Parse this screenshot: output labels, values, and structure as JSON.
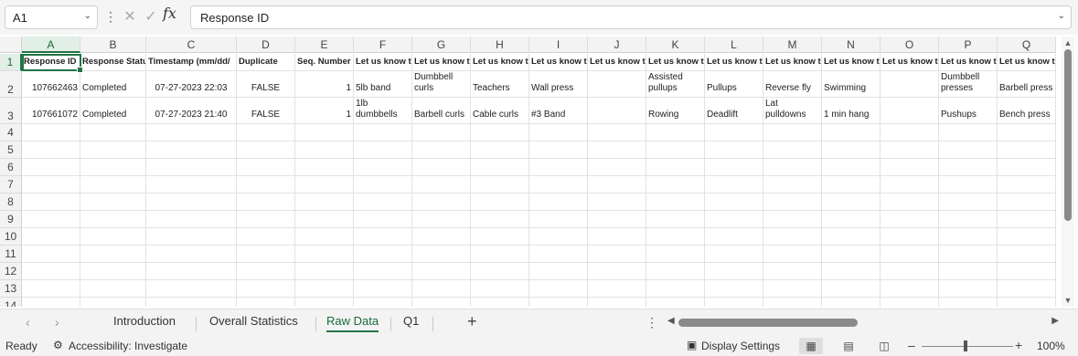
{
  "formula_bar": {
    "name_box": "A1",
    "formula": "Response ID",
    "fx_label": "fx"
  },
  "columns": [
    "A",
    "B",
    "C",
    "D",
    "E",
    "F",
    "G",
    "H",
    "I",
    "J",
    "K",
    "L",
    "M",
    "N",
    "O",
    "P",
    "Q"
  ],
  "row_numbers": [
    "1",
    "2",
    "3",
    "4",
    "5",
    "6",
    "7",
    "8",
    "9",
    "10",
    "11",
    "12",
    "13",
    "14"
  ],
  "headers": {
    "A": "Response ID",
    "B": "Response Statu",
    "C": "Timestamp (mm/dd/",
    "D": "Duplicate",
    "E": "Seq. Number",
    "F": "Let us know t",
    "G": "Let us know t",
    "H": "Let us know t",
    "I": "Let us know t",
    "J": "Let us know t",
    "K": "Let us know t",
    "L": "Let us know t",
    "M": "Let us know t",
    "N": "Let us know t",
    "O": "Let us know t",
    "P": "Let us know t",
    "Q": "Let us know t"
  },
  "rows": [
    {
      "A": "107662463",
      "B": "Completed",
      "C": "07-27-2023 22:03",
      "D": "FALSE",
      "E": "1",
      "F": "5lb band",
      "G": "Dumbbell curls",
      "H": "Teachers",
      "I": "Wall press",
      "J": "",
      "K": "Assisted pullups",
      "L": "Pullups",
      "M": "Reverse fly",
      "N": "Swimming",
      "O": "",
      "P": "Dumbbell presses",
      "Q": "Barbell press"
    },
    {
      "A": "107661072",
      "B": "Completed",
      "C": "07-27-2023 21:40",
      "D": "FALSE",
      "E": "1",
      "F": "1lb dumbbells",
      "G": "Barbell curls",
      "H": "Cable curls",
      "I": "#3 Band",
      "J": "",
      "K": "Rowing",
      "L": "Deadlift",
      "M": "Lat pulldowns",
      "N": "1 min hang",
      "O": "",
      "P": "Pushups",
      "Q": "Bench press"
    }
  ],
  "sheet_tabs": [
    "Introduction",
    "Overall Statistics",
    "Raw Data",
    "Q1"
  ],
  "active_sheet": "Raw Data",
  "status_bar": {
    "ready": "Ready",
    "accessibility": "Accessibility: Investigate",
    "display_settings": "Display Settings",
    "zoom": "100%"
  }
}
